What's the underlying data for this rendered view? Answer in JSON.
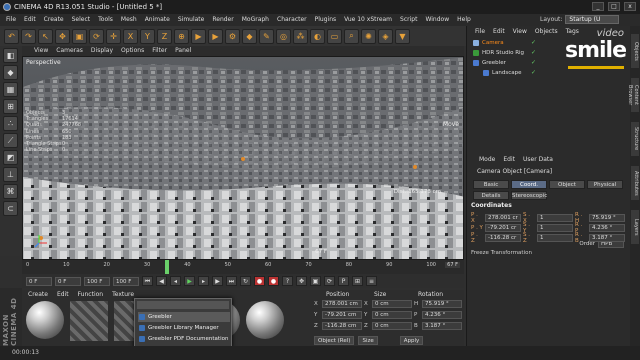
{
  "titlebar": {
    "title": "CINEMA 4D R13.051 Studio - [Untitled 5 *]",
    "min": "_",
    "max": "□",
    "close": "x"
  },
  "menubar": [
    "File",
    "Edit",
    "Create",
    "Select",
    "Tools",
    "Mesh",
    "Animate",
    "Simulate",
    "Render",
    "MoGraph",
    "Character",
    "Plugins",
    "Vue 10 xStream",
    "Script",
    "Window",
    "Help"
  ],
  "layout": {
    "label": "Layout:",
    "value": "Startup (U"
  },
  "viewport": {
    "menu": [
      "View",
      "Cameras",
      "Display",
      "Options",
      "Filter",
      "Panel"
    ],
    "label": "Perspective",
    "stats": [
      {
        "k": "Objects",
        "v": "3"
      },
      {
        "k": "Triangles",
        "v": "17614"
      },
      {
        "k": "Quads",
        "v": "247768"
      },
      {
        "k": "Lines",
        "v": "650"
      },
      {
        "k": "Points",
        "v": "183"
      },
      {
        "k": "Triangle Strips",
        "v": "0"
      },
      {
        "k": "Line Strips",
        "v": "0"
      }
    ],
    "move_label": "Move",
    "dist_label": "Dist.:165.173 cm",
    "gc_label": "67 F"
  },
  "timeline": {
    "ticks": [
      "0",
      "10",
      "20",
      "30",
      "40",
      "50",
      "60",
      "70",
      "80",
      "90",
      "100"
    ],
    "playhead_frame": 34,
    "end_frame": "67 F"
  },
  "transport": {
    "start": "0 F",
    "cur": "0 F",
    "end": "100 F",
    "end2": "100 F"
  },
  "material": {
    "menu": [
      "Create",
      "Edit",
      "Function",
      "Texture"
    ]
  },
  "plugins_menu": {
    "items": [
      "Greebler",
      "Greebler Library Manager",
      "Greebler PDF Documentation"
    ]
  },
  "coord_panel": {
    "headers": [
      "Position",
      "Size",
      "Rotation"
    ],
    "rows": [
      {
        "ax": "X",
        "pos": "278.001 cm",
        "sax": "X",
        "size": "0 cm",
        "rax": "H",
        "rot": "75.919 °"
      },
      {
        "ax": "Y",
        "pos": "-79.201 cm",
        "sax": "Y",
        "size": "0 cm",
        "rax": "P",
        "rot": "4.236 °"
      },
      {
        "ax": "Z",
        "pos": "-116.28 cm",
        "sax": "Z",
        "size": "0 cm",
        "rax": "B",
        "rot": "3.187 °"
      }
    ],
    "mode": "Object (Rel)",
    "size_mode": "Size",
    "apply": "Apply"
  },
  "objects": {
    "menu": [
      "File",
      "Edit",
      "View",
      "Objects",
      "Tags"
    ],
    "items": [
      {
        "name": "Camera",
        "color": "#8ab0e0",
        "selected": true
      },
      {
        "name": "HDR Studio Rig",
        "color": "#3a9a3a",
        "selected": false
      },
      {
        "name": "Greebler",
        "color": "#4a7ad0",
        "selected": false
      },
      {
        "name": "Landscape",
        "color": "#4a7ad0",
        "selected": false
      }
    ]
  },
  "brand": {
    "line1": "video",
    "line2": "smile"
  },
  "attributes": {
    "menu": [
      "Mode",
      "Edit",
      "User Data"
    ],
    "title": "Camera Object [Camera]",
    "tabs": [
      "Basic",
      "Coord.",
      "Object",
      "Physical",
      "Details",
      "Stereoscopic"
    ],
    "active_tab": "Coord.",
    "section": "Coordinates",
    "rows": [
      {
        "l": "P . X",
        "v": "278.001 cr",
        "sl": "S . X",
        "sv": "1",
        "rl": "R . H",
        "rv": "75.919 °"
      },
      {
        "l": "P . Y",
        "v": "-79.201 cr",
        "sl": "S . Y",
        "sv": "1",
        "rl": "R . P",
        "rv": "4.236 °"
      },
      {
        "l": "P . Z",
        "v": "-116.28 cr",
        "sl": "S . Z",
        "sv": "1",
        "rl": "R . B",
        "rv": "3.187 °"
      }
    ],
    "order_label": "Order",
    "order_value": "HPB",
    "freeze": "Freeze Transformation"
  },
  "right_tabs": [
    "Objects",
    "Content Browser",
    "Structure",
    "Attributes",
    "Layers"
  ],
  "status": "00:00:13"
}
